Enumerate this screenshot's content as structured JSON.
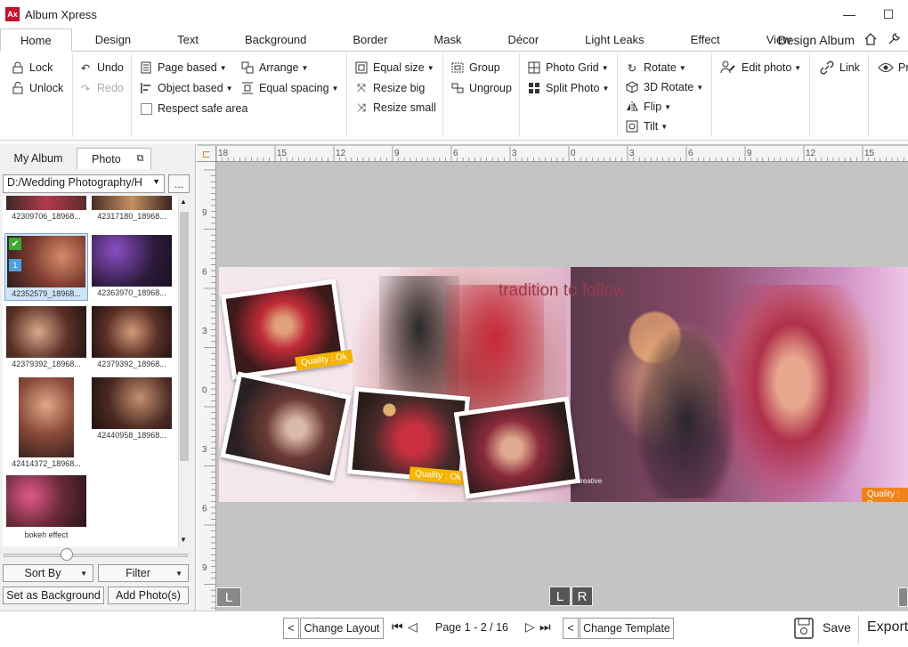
{
  "app": {
    "logo_text": "Ax",
    "title": "Album Xpress"
  },
  "window": {
    "minimize": "—",
    "maximize": "☐"
  },
  "menu": {
    "tabs": [
      "Home",
      "Design",
      "Text",
      "Background",
      "Border",
      "Mask",
      "Décor",
      "Light Leaks",
      "Effect",
      "View"
    ],
    "design_album": "Design Album"
  },
  "ribbon": {
    "lock": "Lock",
    "unlock": "Unlock",
    "undo": "Undo",
    "redo": "Redo",
    "page_based": "Page based",
    "object_based": "Object based",
    "respect_safe_area": "Respect safe area",
    "arrange": "Arrange",
    "equal_spacing": "Equal spacing",
    "equal_size": "Equal size",
    "resize_big": "Resize big",
    "resize_small": "Resize small",
    "group": "Group",
    "ungroup": "Ungroup",
    "photo_grid": "Photo Grid",
    "split_photo": "Split Photo",
    "rotate": "Rotate",
    "rotate_3d": "3D Rotate",
    "flip": "Flip",
    "tilt": "Tilt",
    "edit_photo": "Edit photo",
    "link": "Link",
    "preview_partial": "Pr"
  },
  "left_panel": {
    "tab_my_album": "My Album",
    "tab_photo": "Photo",
    "path": "D:/Wedding Photography/H",
    "browse": "...",
    "thumbnails": [
      {
        "caption": "42309706_18968...",
        "selected": false
      },
      {
        "caption": "42317180_18968...",
        "selected": false
      },
      {
        "caption": "42352579_18968...",
        "selected": true,
        "badge": "1"
      },
      {
        "caption": "42363970_18968...",
        "selected": false
      },
      {
        "caption": "42379392_18968...",
        "selected": false
      },
      {
        "caption": "42379392_18968...",
        "selected": false
      },
      {
        "caption": "42414372_18968...",
        "selected": false
      },
      {
        "caption": "42440958_18968...",
        "selected": false
      },
      {
        "caption": "bokeh effect",
        "selected": false
      }
    ],
    "zoom_fraction": 0.33,
    "sort_by": "Sort By",
    "filter": "Filter",
    "set_as_background": "Set as Background",
    "add_photos": "Add Photo(s)"
  },
  "rulers": {
    "top_ticks": [
      "18",
      "15",
      "12",
      "9",
      "6",
      "3",
      "0",
      "3",
      "6",
      "9",
      "12",
      "15"
    ],
    "left_ticks": [
      "9",
      "6",
      "3",
      "0",
      "3",
      "6",
      "9"
    ]
  },
  "spread": {
    "headline": "tradition to follow",
    "quality_1": "Quality : Ok",
    "quality_2": "Quality : Ok",
    "quality_3": "Quality : B",
    "watermark": "s creative"
  },
  "page_buttons": {
    "left": "L",
    "right": "R"
  },
  "bottom": {
    "prev": "<",
    "change_layout": "Change Layout",
    "page_label": "Page 1 - 2 / 16",
    "prev2": "<",
    "change_template": "Change Template",
    "save": "Save",
    "export": "Export"
  }
}
